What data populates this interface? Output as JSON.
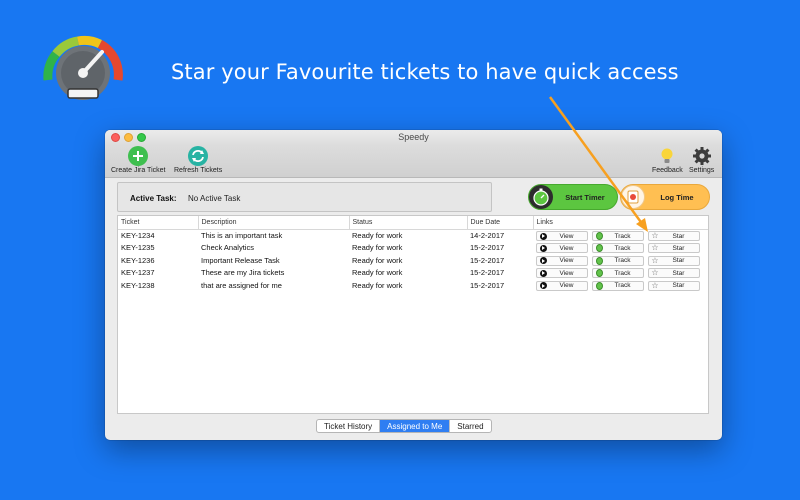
{
  "headline": "Star your Favourite tickets to have quick access",
  "colors": {
    "background": "#1877f2",
    "accent": "#f7a020",
    "selected_segment": "#2f7ef2"
  },
  "window": {
    "title": "Speedy",
    "toolbar": {
      "create": {
        "label": "Create Jira Ticket",
        "icon": "plus-circle-icon"
      },
      "refresh": {
        "label": "Refresh Tickets",
        "icon": "refresh-icon"
      },
      "feedback": {
        "label": "Feedback",
        "icon": "lightbulb-icon"
      },
      "settings": {
        "label": "Settings",
        "icon": "gear-icon"
      }
    },
    "active_task": {
      "label": "Active Task:",
      "value": "No Active Task"
    },
    "start_timer": {
      "label": "Start Timer",
      "icon": "stopwatch-icon"
    },
    "log_time": {
      "label": "Log Time",
      "icon": "clock-log-icon"
    },
    "table": {
      "columns": [
        "Ticket",
        "Description",
        "Status",
        "Due Date",
        "Links"
      ],
      "rows": [
        {
          "ticket": "KEY-1234",
          "description": "This is an important task",
          "status": "Ready for work",
          "due": "14-2-2017"
        },
        {
          "ticket": "KEY-1235",
          "description": "Check Analytics",
          "status": "Ready for work",
          "due": "15-2-2017"
        },
        {
          "ticket": "KEY-1236",
          "description": "Important Release Task",
          "status": "Ready for work",
          "due": "15-2-2017"
        },
        {
          "ticket": "KEY-1237",
          "description": "These are my Jira tickets",
          "status": "Ready for work",
          "due": "15-2-2017"
        },
        {
          "ticket": "KEY-1238",
          "description": "that are assigned for me",
          "status": "Ready for work",
          "due": "15-2-2017"
        }
      ],
      "link_labels": {
        "view": "View",
        "track": "Track",
        "star": "Star"
      }
    },
    "tabs": [
      {
        "label": "Ticket History",
        "selected": false
      },
      {
        "label": "Assigned to Me",
        "selected": true
      },
      {
        "label": "Starred",
        "selected": false
      }
    ]
  }
}
